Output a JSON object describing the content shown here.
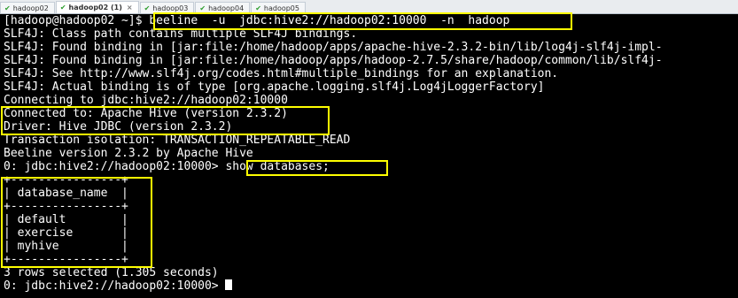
{
  "tabs": [
    {
      "label": "hadoop02"
    },
    {
      "label": "hadoop02 (1)",
      "close": "×"
    },
    {
      "label": "hadoop03"
    },
    {
      "label": "hadoop04"
    },
    {
      "label": "hadoop05"
    }
  ],
  "terminal": {
    "lines": [
      "[hadoop@hadoop02 ~]$ beeline  -u  jdbc:hive2://hadoop02:10000  -n  hadoop",
      "SLF4J: Class path contains multiple SLF4J bindings.",
      "SLF4J: Found binding in [jar:file:/home/hadoop/apps/apache-hive-2.3.2-bin/lib/log4j-slf4j-impl-",
      "SLF4J: Found binding in [jar:file:/home/hadoop/apps/hadoop-2.7.5/share/hadoop/common/lib/slf4j-",
      "SLF4J: See http://www.slf4j.org/codes.html#multiple_bindings for an explanation.",
      "SLF4J: Actual binding is of type [org.apache.logging.slf4j.Log4jLoggerFactory]",
      "Connecting to jdbc:hive2://hadoop02:10000",
      "Connected to: Apache Hive (version 2.3.2)",
      "Driver: Hive JDBC (version 2.3.2)",
      "Transaction isolation: TRANSACTION_REPEATABLE_READ",
      "Beeline version 2.3.2 by Apache Hive",
      "0: jdbc:hive2://hadoop02:10000> show databases;",
      "+----------------+",
      "| database_name  |",
      "+----------------+",
      "| default        |",
      "| exercise       |",
      "| myhive         |",
      "+----------------+",
      "3 rows selected (1.305 seconds)",
      "0: jdbc:hive2://hadoop02:10000> "
    ]
  },
  "colors": {
    "highlight": "#ffff00",
    "background": "#000000",
    "text": "#ffffff"
  }
}
